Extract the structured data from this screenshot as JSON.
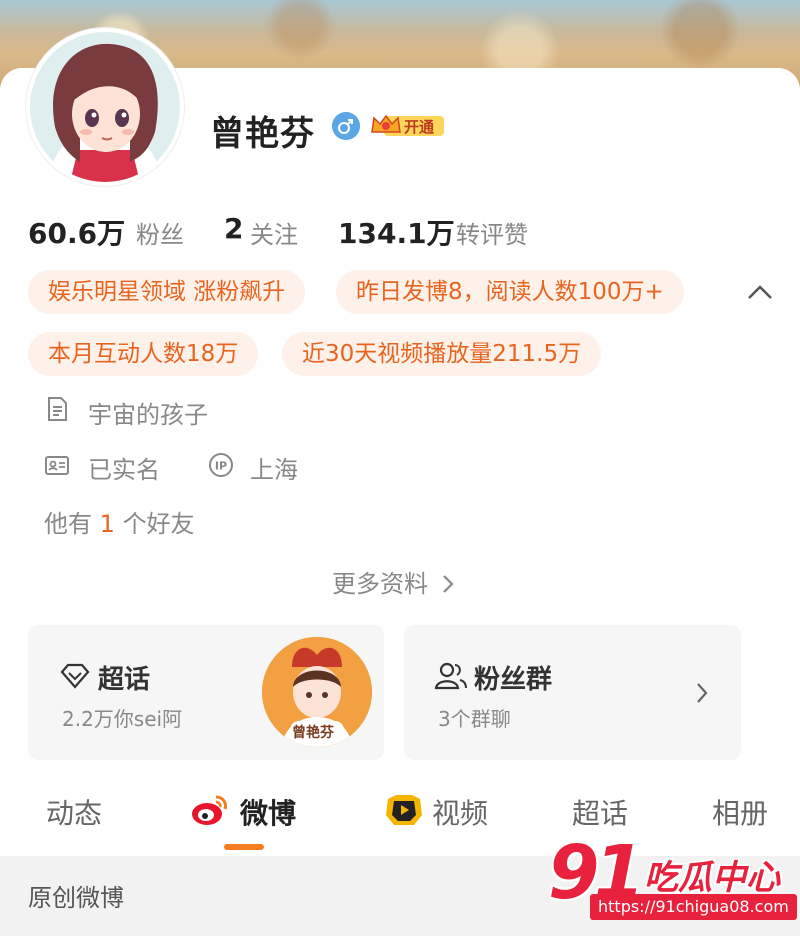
{
  "profile": {
    "name": "曾艳芬",
    "gender_icon": "male-icon",
    "vip_label": "开通"
  },
  "stats": {
    "fans_num": "60.6万",
    "fans_label": "粉丝",
    "follow_num": "2",
    "follow_label": "关注",
    "likes_num": "134.1万",
    "likes_label": "转评赞"
  },
  "tags": [
    "娱乐明星领域 涨粉飙升",
    "昨日发博8，阅读人数100万+",
    "本月互动人数18万",
    "近30天视频播放量211.5万"
  ],
  "info": {
    "bio": "宇宙的孩子",
    "verified": "已实名",
    "ip_location": "上海",
    "friends_prefix": "他有",
    "friends_count": "1",
    "friends_suffix": "个好友"
  },
  "more_label": "更多资料",
  "cards": {
    "super_topic": {
      "title": "超话",
      "sub": "2.2万你sei阿",
      "thumb_text": "曾艳芬"
    },
    "fan_group": {
      "title": "粉丝群",
      "sub": "3个群聊"
    }
  },
  "tabs": [
    "动态",
    "微博",
    "视频",
    "超话",
    "相册"
  ],
  "section_title": "原创微博",
  "watermark": {
    "number": "91",
    "cn": "吃瓜中心",
    "url": "https://91chigua08.com"
  },
  "colors": {
    "accent": "#e8651f",
    "tag_bg": "#fdf1ea",
    "tab_active_underline": "#f57c1f",
    "watermark": "#e8213c"
  }
}
